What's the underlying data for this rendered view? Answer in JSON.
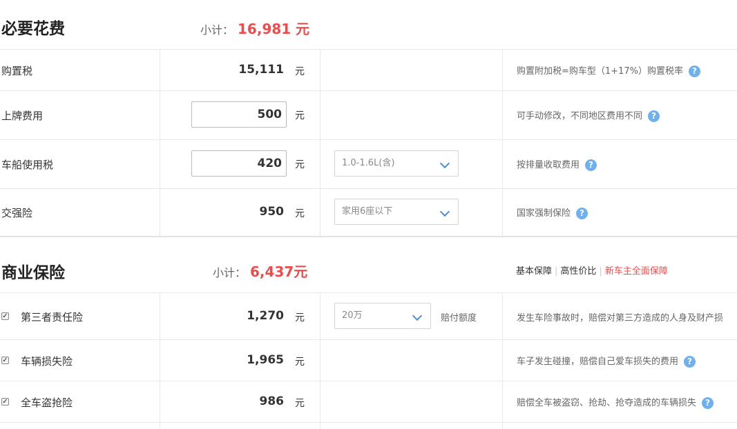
{
  "section1": {
    "title": "必要花费",
    "subtotal_label": "小计：",
    "subtotal_value": "16,981 元",
    "rows": [
      {
        "label": "购置税",
        "value": "15,111",
        "unit": "元",
        "desc": "购置附加税=购车型（1+17%）购置税率"
      },
      {
        "label": "上牌费用",
        "value": "500",
        "unit": "元",
        "desc": "可手动修改，不同地区费用不同"
      },
      {
        "label": "车船使用税",
        "value": "420",
        "unit": "元",
        "select": "1.0-1.6L(含)",
        "desc": "按排量收取费用"
      },
      {
        "label": "交强险",
        "value": "950",
        "unit": "元",
        "select": "家用6座以下",
        "desc": "国家强制保险"
      }
    ]
  },
  "section2": {
    "title": "商业保险",
    "subtotal_label": "小计：",
    "subtotal_value": "6,437元",
    "tabs": [
      "基本保障",
      "高性价比",
      "新车主全面保障"
    ],
    "rows": [
      {
        "label": "第三者责任险",
        "value": "1,270",
        "unit": "元",
        "select": "20万",
        "select_note": "赔付额度",
        "desc": "发生车险事故时，赔偿对第三方造成的人身及财产损",
        "checked": true
      },
      {
        "label": "车辆损失险",
        "value": "1,965",
        "unit": "元",
        "desc": "车子发生碰撞，赔偿自己爱车损失的费用",
        "checked": true
      },
      {
        "label": "全车盗抢险",
        "value": "986",
        "unit": "元",
        "desc": "赔偿全车被盗窃、抢劫、抢夺造成的车辆损失",
        "checked": true
      }
    ]
  },
  "icons": {
    "help": "question-circle-icon",
    "chevron": "chevron-down-icon",
    "checkbox": "checkbox-checked-icon"
  },
  "colors": {
    "accent_red": "#f04b4b",
    "help_blue": "#6fb1ef",
    "chevron_blue": "#4a8fd8"
  }
}
